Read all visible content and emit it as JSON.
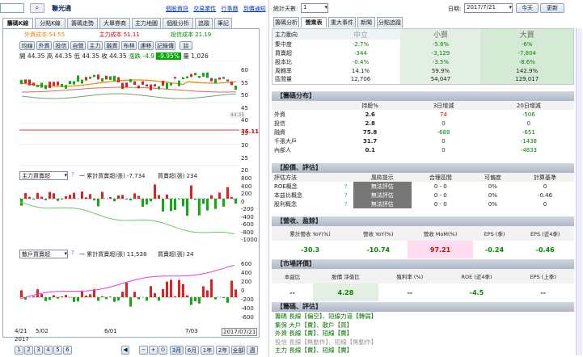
{
  "stock": {
    "code_value": "",
    "name": "聯光通",
    "links": [
      "個股資訊",
      "交易業性",
      "行事曆",
      "到價通知"
    ]
  },
  "left_tabs": [
    "籌碼K線",
    "分點K線",
    "籌碼走勢",
    "大單券商",
    "主力地圖",
    "個股分析",
    "追蹤",
    "筆記"
  ],
  "chart_legend": {
    "ma1": "外資成本 54.55",
    "ma2": "主力成本 51.11",
    "ma3": "投信成本 21.19"
  },
  "chip_buttons": [
    "均線",
    "外資",
    "投信",
    "自營",
    "主力",
    "融資",
    "布林",
    "連移",
    "記錄傳",
    "談"
  ],
  "ohlc": {
    "open": "開 44.35",
    "high": "高 44.35",
    "low": "低 44.35",
    "close": "收 44.35",
    "change": "漲跌 -4.9",
    "pct": "-9.95%",
    "vol_label": "量",
    "vol": "1,026"
  },
  "price_axis": [
    "60",
    "55",
    "50",
    "45",
    "40",
    "35",
    "30",
    "25",
    "20"
  ],
  "price_label": "44.35",
  "price_label2": "35.11",
  "sub1": {
    "select": "主力買賣超",
    "legend": "一 累計買賣超(張) -7,734",
    "legend2": "買賣超(張) 234",
    "axis": [
      "800",
      "400",
      "200",
      "0",
      "-200",
      "-400",
      "-600",
      "-800",
      "-1000"
    ]
  },
  "sub2": {
    "select": "散戶買賣超",
    "legend": "一 累計買賣超(張) 11,538",
    "legend2": "買賣超(張) 24",
    "axis": [
      "600",
      "400",
      "200",
      "0",
      "-200",
      "-400",
      "-600"
    ]
  },
  "dates": [
    "4/21",
    "5/02",
    "6/01",
    "7/03",
    "2017/07/21"
  ],
  "year": "2017",
  "pager": [
    "1",
    "2",
    "3",
    "4",
    "5",
    "6"
  ],
  "zoom": [
    "3月",
    "6月",
    "1年",
    "2年",
    "全部",
    "週"
  ],
  "right_top": {
    "days_label": "統計天數:",
    "days": "1",
    "date_label": "日期:",
    "date": "2017/7/21",
    "today": "今天",
    "refresh": "更新"
  },
  "right_tabs": [
    "籌碼分析",
    "營業表",
    "重大事件",
    "新聞",
    "分點追蹤"
  ],
  "main_table": {
    "headers": [
      "主力動向",
      "中立",
      "小買",
      "大買"
    ],
    "rows": [
      [
        "集中度",
        "-2.7%",
        "-5.8%",
        "-6%"
      ],
      [
        "買賣超",
        "-344",
        "-3,129",
        "-7,804"
      ],
      [
        "股本比",
        "-0.4%",
        "-3.5%",
        "-8.6%"
      ],
      [
        "周轉率",
        "14.1%",
        "59.9%",
        "142.9%"
      ],
      [
        "區間量",
        "12,706",
        "54,047",
        "129,017"
      ]
    ]
  },
  "dist": {
    "title": "【籌碼分布】",
    "headers": [
      "",
      "持股%",
      "3日增減",
      "20日增減"
    ],
    "rows": [
      [
        "外資",
        "2.6",
        "74",
        "-506"
      ],
      [
        "投信",
        "2.8",
        "0",
        "0"
      ],
      [
        "融資",
        "75.8",
        "-688",
        "-651"
      ],
      [
        "千張大戶",
        "31.7",
        "0",
        "-1438"
      ],
      [
        "內部人",
        "0.1",
        "0",
        "-4833"
      ]
    ]
  },
  "valuation": {
    "title": "【股價、評估】",
    "headers": [
      "評估方法",
      "",
      "風險提示",
      "合理區間",
      "可偏度",
      "計算基準"
    ],
    "rows": [
      [
        "ROE概念",
        "無法評估",
        "0 - 0",
        "0%",
        "0"
      ],
      [
        "本益比概念",
        "無法評估",
        "0 - 0",
        "0%",
        "-0.46"
      ],
      [
        "股利概念",
        "無法評估",
        "0 - 0",
        "0%",
        "0"
      ]
    ]
  },
  "revenue": {
    "title": "【營收、盈餘】",
    "headers": [
      "累計營收 YoY(%)",
      "營收 YoY(%)",
      "營收 MoM(%)",
      "EPS (季)",
      "EPS (近4季)"
    ],
    "values": [
      "-30.3",
      "-10.74",
      "97.21",
      "-0.24",
      "-0.46"
    ]
  },
  "market": {
    "title": "【市場評價】",
    "headers": [
      "本益比",
      "股價 淨值比",
      "殖利率 (%)",
      "ROE (近4季)",
      "EPS (上季)"
    ],
    "values": [
      "--",
      "4.28",
      "--",
      "-4.5",
      "--"
    ]
  },
  "chip_eval": {
    "title": "【籌碼、評估】",
    "lines": [
      "籌碼 長線【偏空】、短線力道【轉弱】",
      "集保 大戶【賣】、散戶【買】",
      "外資 長線【賣】、短線【賣】",
      "投信 長線【無動作】、短線【無動作】",
      "主力 長線【賣】、短線【賣】"
    ]
  }
}
